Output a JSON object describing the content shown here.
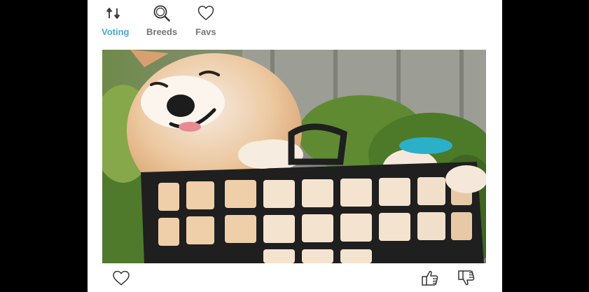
{
  "nav": {
    "items": [
      {
        "label": "Voting",
        "icon": "up-down-arrows-icon",
        "active": true
      },
      {
        "label": "Breeds",
        "icon": "search-icon",
        "active": false
      },
      {
        "label": "Favs",
        "icon": "heart-icon",
        "active": false
      }
    ]
  },
  "image": {
    "alt_subject": "shiba-inu-in-basket"
  },
  "actions": {
    "favourite_icon": "heart-outline-icon",
    "upvote_icon": "thumbs-up-icon",
    "downvote_icon": "thumbs-down-icon"
  },
  "colors": {
    "accent": "#4aa5d6",
    "inactive": "#777777",
    "background": "#000000",
    "card": "#ffffff"
  }
}
